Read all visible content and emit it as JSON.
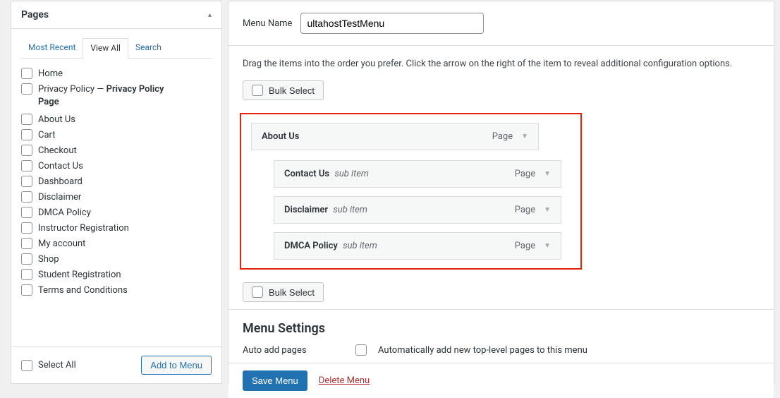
{
  "left": {
    "title": "Pages",
    "tabs": {
      "recent": "Most Recent",
      "viewall": "View All",
      "search": "Search",
      "active": 1
    },
    "items": [
      {
        "label": "Home"
      },
      {
        "label": "Privacy Policy",
        "suffix_sep": " — ",
        "suffix1": "Privacy Policy",
        "suffix2_line": "Page"
      },
      {
        "label": "About Us"
      },
      {
        "label": "Cart"
      },
      {
        "label": "Checkout"
      },
      {
        "label": "Contact Us"
      },
      {
        "label": "Dashboard"
      },
      {
        "label": "Disclaimer"
      },
      {
        "label": "DMCA Policy"
      },
      {
        "label": "Instructor Registration"
      },
      {
        "label": "My account"
      },
      {
        "label": "Shop"
      },
      {
        "label": "Student Registration"
      },
      {
        "label": "Terms and Conditions"
      }
    ],
    "select_all": "Select All",
    "add_button": "Add to Menu"
  },
  "right": {
    "menu_name_label": "Menu Name",
    "menu_name_value": "ultahostTestMenu",
    "hint": "Drag the items into the order you prefer. Click the arrow on the right of the item to reveal additional configuration options.",
    "bulk_select": "Bulk Select",
    "menu_items": [
      {
        "name": "About Us",
        "type": "Page",
        "sub": false
      },
      {
        "name": "Contact Us",
        "type": "Page",
        "sub": true,
        "subtag": "sub item"
      },
      {
        "name": "Disclaimer",
        "type": "Page",
        "sub": true,
        "subtag": "sub item"
      },
      {
        "name": "DMCA Policy",
        "type": "Page",
        "sub": true,
        "subtag": "sub item"
      }
    ],
    "settings": {
      "heading": "Menu Settings",
      "auto_add_label": "Auto add pages",
      "auto_add_checkbox": "Automatically add new top-level pages to this menu"
    },
    "save_button": "Save Menu",
    "delete_link": "Delete Menu"
  }
}
